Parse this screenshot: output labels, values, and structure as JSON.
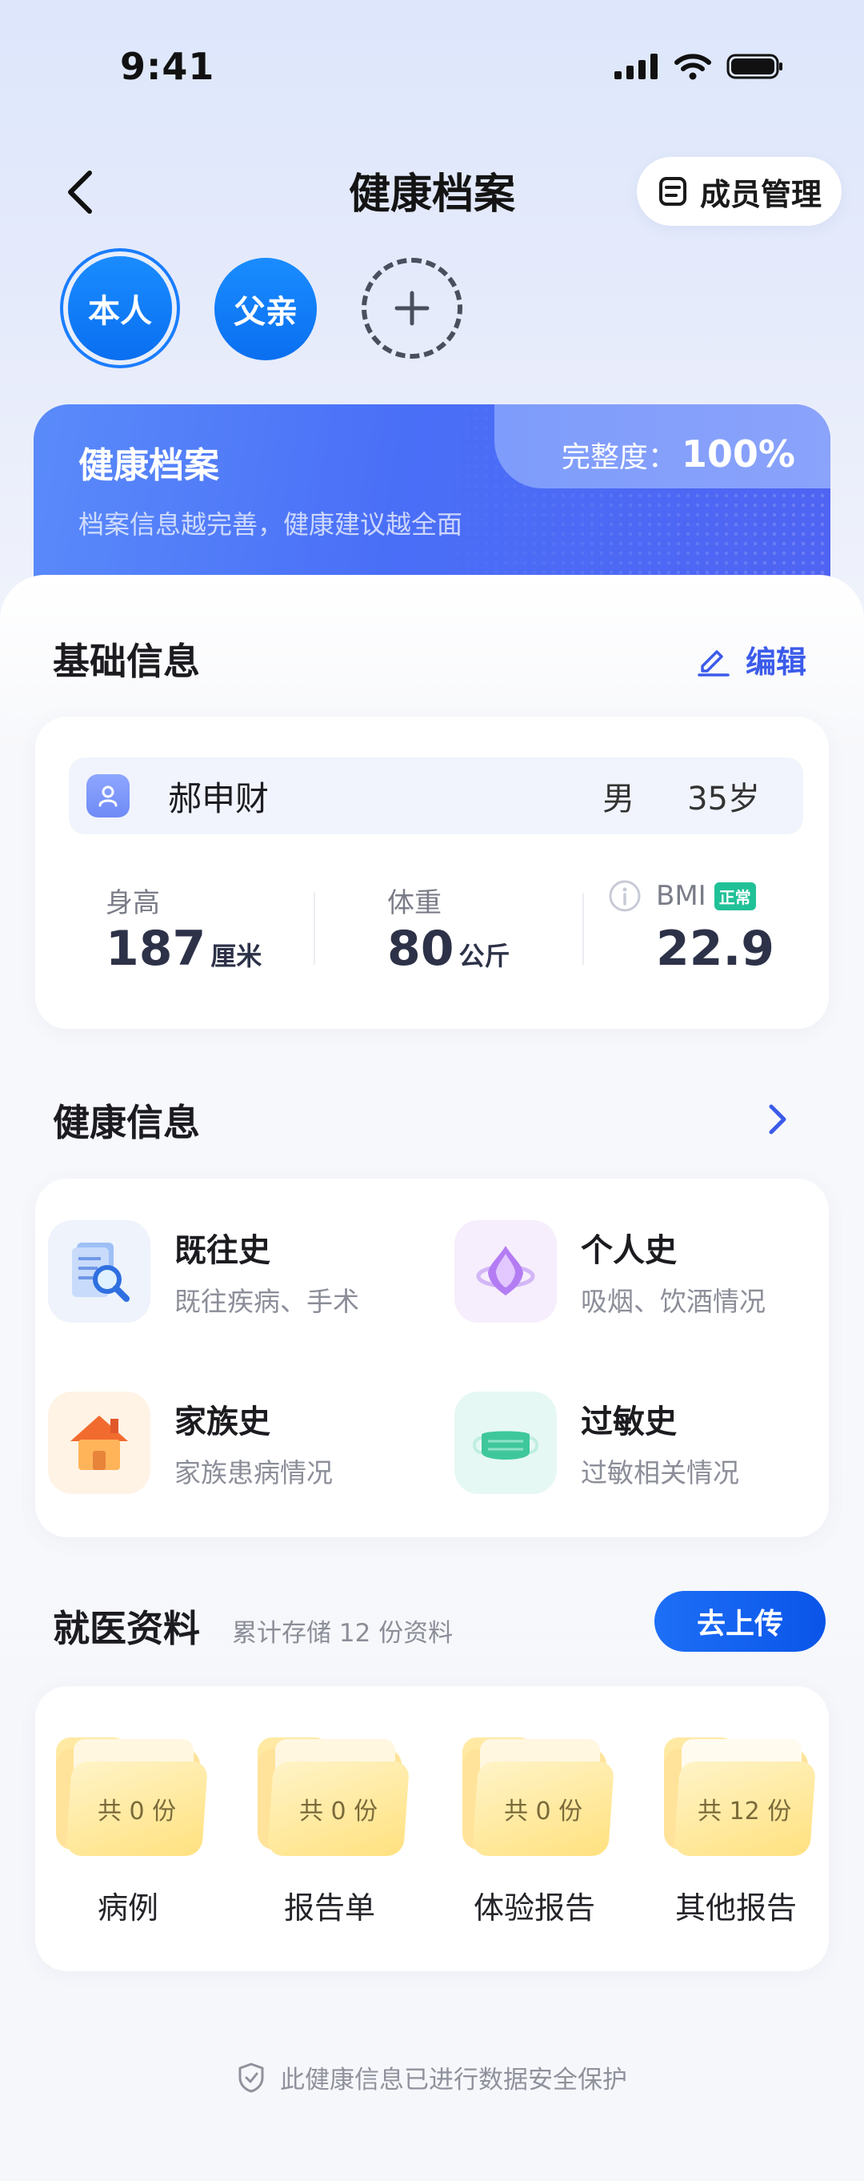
{
  "status_bar": {
    "time": "9:41"
  },
  "nav": {
    "title": "健康档案",
    "member_button": "成员管理"
  },
  "members": [
    {
      "label": "本人",
      "selected": true
    },
    {
      "label": "父亲",
      "selected": false
    }
  ],
  "banner": {
    "title": "健康档案",
    "subtitle": "档案信息越完善，健康建议越全面",
    "completeness_label": "完整度：",
    "completeness_value": "100%"
  },
  "basic_info": {
    "title": "基础信息",
    "edit_label": "编辑",
    "name": "郝申财",
    "gender": "男",
    "age": "35岁",
    "height_label": "身高",
    "height_value": "187",
    "height_unit": "厘米",
    "weight_label": "体重",
    "weight_value": "80",
    "weight_unit": "公斤",
    "bmi_label": "BMI",
    "bmi_badge": "正常",
    "bmi_value": "22.9"
  },
  "health_info": {
    "title": "健康信息",
    "items": [
      {
        "title": "既往史",
        "subtitle": "既往疾病、手术",
        "icon": "magnifier-document-icon"
      },
      {
        "title": "个人史",
        "subtitle": "吸烟、饮酒情况",
        "icon": "personal-orb-icon"
      },
      {
        "title": "家族史",
        "subtitle": "家族患病情况",
        "icon": "house-icon"
      },
      {
        "title": "过敏史",
        "subtitle": "过敏相关情况",
        "icon": "face-mask-icon"
      }
    ]
  },
  "medical_docs": {
    "title": "就医资料",
    "summary": "累计存储 12 份资料",
    "upload_label": "去上传",
    "folders": [
      {
        "count": "共 0 份",
        "label": "病例"
      },
      {
        "count": "共 0 份",
        "label": "报告单"
      },
      {
        "count": "共 0 份",
        "label": "体验报告"
      },
      {
        "count": "共 12 份",
        "label": "其他报告"
      }
    ]
  },
  "footer": {
    "text": "此健康信息已进行数据安全保护"
  },
  "colors": {
    "accent": "#1a7dff",
    "banner": "#4f6ff5",
    "edit": "#3b5bea",
    "badge_normal": "#21c197"
  }
}
